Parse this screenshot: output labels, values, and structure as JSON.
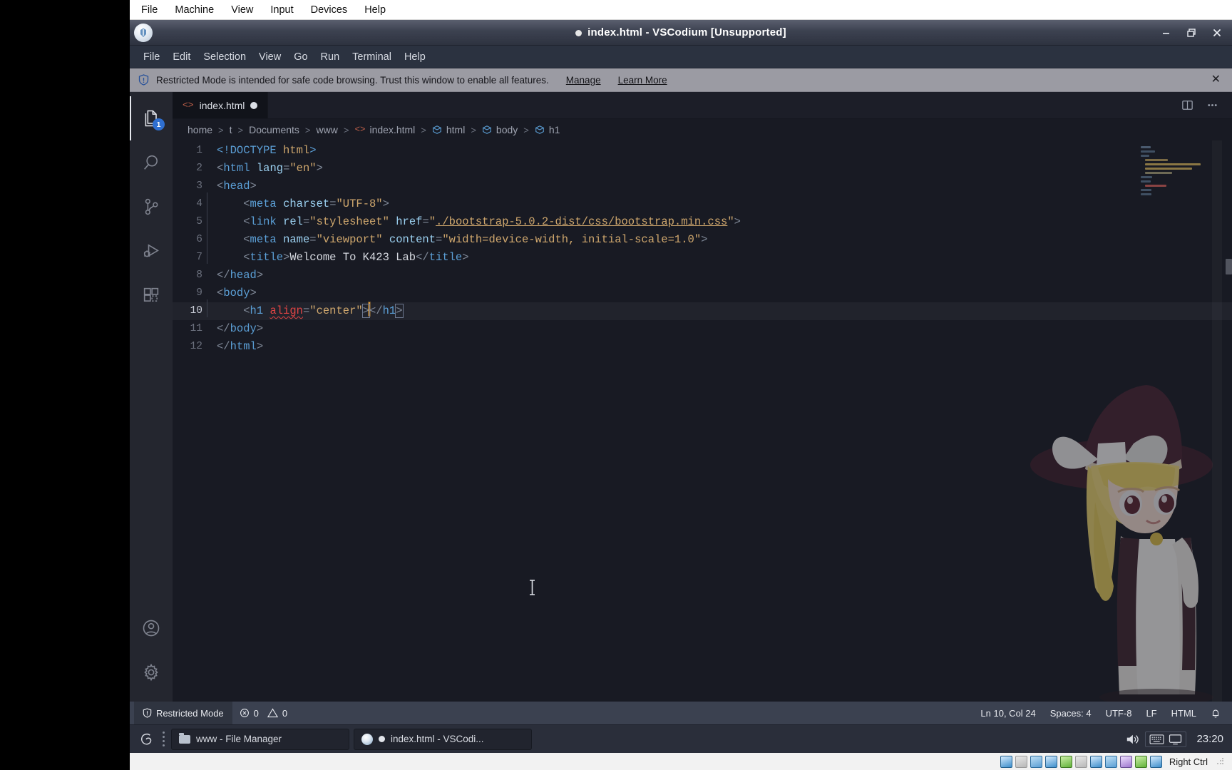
{
  "virtualbox": {
    "menu": [
      "File",
      "Machine",
      "View",
      "Input",
      "Devices",
      "Help"
    ],
    "status_label": "Right Ctrl",
    "tray_icons": [
      "hard-disk-icon",
      "optical-disk-icon",
      "audio-icon",
      "network-icon",
      "usb-icon",
      "shared-folder-icon",
      "display-icon",
      "recording-icon",
      "virtualization-icon",
      "mouse-integration-icon",
      "guest-additions-icon"
    ]
  },
  "window": {
    "title": "index.html - VSCodium [Unsupported]",
    "dirty": true,
    "controls": {
      "minimize": "–",
      "maximize": "❐",
      "close": "✕"
    }
  },
  "menubar": [
    "File",
    "Edit",
    "Selection",
    "View",
    "Go",
    "Run",
    "Terminal",
    "Help"
  ],
  "trust_banner": {
    "icon": "shield-icon",
    "message": "Restricted Mode is intended for safe code browsing. Trust this window to enable all features.",
    "manage_label": "Manage",
    "learn_more_label": "Learn More",
    "close_label": "✕"
  },
  "activity_bar": {
    "items": [
      {
        "name": "explorer",
        "badge": "1",
        "active": true
      },
      {
        "name": "search",
        "badge": "",
        "active": false
      },
      {
        "name": "source-control",
        "badge": "",
        "active": false
      },
      {
        "name": "run-and-debug",
        "badge": "",
        "active": false
      },
      {
        "name": "extensions",
        "badge": "",
        "active": false
      }
    ],
    "bottom_items": [
      {
        "name": "accounts"
      },
      {
        "name": "manage-settings"
      }
    ]
  },
  "tabs": [
    {
      "label": "index.html",
      "icon": "html-file-icon",
      "dirty": true,
      "active": true
    }
  ],
  "editor_actions": [
    "split-editor-icon",
    "more-actions-icon"
  ],
  "breadcrumbs": [
    {
      "label": "home",
      "icon": ""
    },
    {
      "label": "t",
      "icon": ""
    },
    {
      "label": "Documents",
      "icon": ""
    },
    {
      "label": "www",
      "icon": ""
    },
    {
      "label": "index.html",
      "icon": "html-file-icon"
    },
    {
      "label": "html",
      "icon": "symbol-cube-icon"
    },
    {
      "label": "body",
      "icon": "symbol-cube-icon"
    },
    {
      "label": "h1",
      "icon": "symbol-cube-icon"
    }
  ],
  "code": {
    "language": "HTML",
    "lines": [
      {
        "n": "1",
        "text": "<!DOCTYPE html>"
      },
      {
        "n": "2",
        "text": "<html lang=\"en\">"
      },
      {
        "n": "3",
        "text": "<head>"
      },
      {
        "n": "4",
        "text": "    <meta charset=\"UTF-8\">"
      },
      {
        "n": "5",
        "text": "    <link rel=\"stylesheet\" href=\"./bootstrap-5.0.2-dist/css/bootstrap.min.css\">"
      },
      {
        "n": "6",
        "text": "    <meta name=\"viewport\" content=\"width=device-width, initial-scale=1.0\">"
      },
      {
        "n": "7",
        "text": "    <title>Welcome To K423 Lab</title>"
      },
      {
        "n": "8",
        "text": "</head>"
      },
      {
        "n": "9",
        "text": "<body>"
      },
      {
        "n": "10",
        "text": "    <h1 align=\"center\"></h1>",
        "current": true
      },
      {
        "n": "11",
        "text": "</body>"
      },
      {
        "n": "12",
        "text": "</html>"
      }
    ]
  },
  "status_bar": {
    "restricted_mode": "Restricted Mode",
    "errors": "0",
    "warnings": "0",
    "position": "Ln 10, Col 24",
    "indentation": "Spaces: 4",
    "encoding": "UTF-8",
    "eol": "LF",
    "language": "HTML",
    "bell": "notifications-icon"
  },
  "taskbar": {
    "tasks": [
      {
        "label": "www - File Manager",
        "icon": "folder-icon",
        "dirty": false
      },
      {
        "label": "index.html - VSCodi...",
        "icon": "vscodium-icon",
        "dirty": true
      }
    ],
    "clock": "23:20",
    "tray": [
      "volume-icon",
      "keyboard-icon",
      "display-icon"
    ]
  },
  "colors": {
    "accent": "#2f6fd0",
    "tag": "#5b9fd6",
    "string": "#cfa76d",
    "attribute": "#9bd0f0",
    "deprecated": "#e14444",
    "cursor": "#e8a33d",
    "statusbar_bg": "#3b4150",
    "banner_bg": "#9b9ba3"
  }
}
